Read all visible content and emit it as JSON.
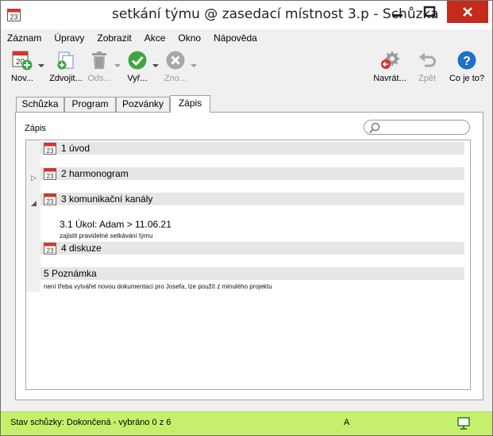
{
  "window": {
    "title": "setkání týmu @ zasedací místnost 3.p - Schůzka",
    "app_icon_day": "23"
  },
  "menu": [
    "Záznam",
    "Úpravy",
    "Zobrazit",
    "Akce",
    "Okno",
    "Nápověda"
  ],
  "toolbar": {
    "new": {
      "label": "Nov...",
      "icon": "calendar-new-icon"
    },
    "duplicate": {
      "label": "Zdvojit...",
      "icon": "duplicate-icon"
    },
    "delete": {
      "label": "Ods...",
      "icon": "trash-icon"
    },
    "complete": {
      "label": "Vyř...",
      "icon": "check-circle-icon"
    },
    "cancel": {
      "label": "Zno...",
      "icon": "x-circle-icon"
    },
    "revert": {
      "label": "Navrát...",
      "icon": "gear-revert-icon"
    },
    "back": {
      "label": "Zpět",
      "icon": "undo-icon"
    },
    "help": {
      "label": "Co je to?",
      "icon": "help-icon"
    }
  },
  "tabs": [
    "Schůzka",
    "Program",
    "Pozvánky",
    "Zápis"
  ],
  "active_tab": "Zápis",
  "panel": {
    "label": "Zápis",
    "search_placeholder": ""
  },
  "items": [
    {
      "title": "1 úvod",
      "day": "23"
    },
    {
      "title": "2 harmonogram",
      "day": "23"
    },
    {
      "title": "3 komunikační kanály",
      "day": "23",
      "sub_title": "3.1 Úkol: Adam > 11.06.21",
      "sub_note": "zajistit pravidelné setkávání týmu"
    },
    {
      "title": "4 diskuze",
      "day": "23"
    },
    {
      "title": "5 Poznámka",
      "note": "není třeba vytvářet novou dokumentaci pro Josefa, lze použít z minulého projektu"
    }
  ],
  "status": {
    "text": "Stav schůzky: Dokončená - vybráno 0 z 6",
    "mode": "A",
    "bg_color": "#c6f06c"
  }
}
